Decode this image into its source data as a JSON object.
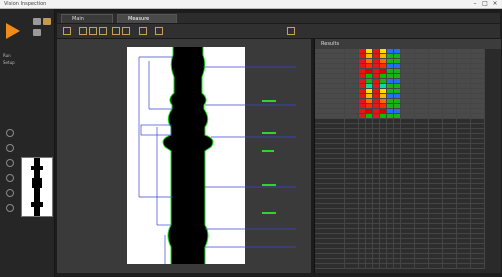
{
  "window": {
    "title": "Vision Inspection"
  },
  "rail": {
    "labels": [
      "Run",
      "Setup"
    ]
  },
  "tabs": [
    {
      "label": "Main"
    },
    {
      "label": "Measure"
    }
  ],
  "results": {
    "title": "Results"
  },
  "colors": {
    "accent": "#f28c18",
    "status_ok": "#19d219",
    "overlay_line": "#3c44d6",
    "overlay_value": "#2fd52f",
    "edge": "#20e020"
  },
  "icons": [
    "play-icon",
    "save-icon",
    "folder-icon",
    "camera-icon",
    "zoom-icon",
    "gear-icon"
  ]
}
